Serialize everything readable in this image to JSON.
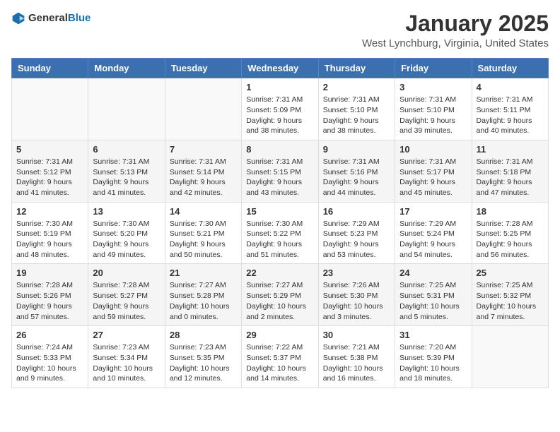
{
  "header": {
    "logo_general": "General",
    "logo_blue": "Blue",
    "month": "January 2025",
    "location": "West Lynchburg, Virginia, United States"
  },
  "weekdays": [
    "Sunday",
    "Monday",
    "Tuesday",
    "Wednesday",
    "Thursday",
    "Friday",
    "Saturday"
  ],
  "rows": [
    [
      {
        "day": "",
        "text": ""
      },
      {
        "day": "",
        "text": ""
      },
      {
        "day": "",
        "text": ""
      },
      {
        "day": "1",
        "text": "Sunrise: 7:31 AM\nSunset: 5:09 PM\nDaylight: 9 hours\nand 38 minutes."
      },
      {
        "day": "2",
        "text": "Sunrise: 7:31 AM\nSunset: 5:10 PM\nDaylight: 9 hours\nand 38 minutes."
      },
      {
        "day": "3",
        "text": "Sunrise: 7:31 AM\nSunset: 5:10 PM\nDaylight: 9 hours\nand 39 minutes."
      },
      {
        "day": "4",
        "text": "Sunrise: 7:31 AM\nSunset: 5:11 PM\nDaylight: 9 hours\nand 40 minutes."
      }
    ],
    [
      {
        "day": "5",
        "text": "Sunrise: 7:31 AM\nSunset: 5:12 PM\nDaylight: 9 hours\nand 41 minutes."
      },
      {
        "day": "6",
        "text": "Sunrise: 7:31 AM\nSunset: 5:13 PM\nDaylight: 9 hours\nand 41 minutes."
      },
      {
        "day": "7",
        "text": "Sunrise: 7:31 AM\nSunset: 5:14 PM\nDaylight: 9 hours\nand 42 minutes."
      },
      {
        "day": "8",
        "text": "Sunrise: 7:31 AM\nSunset: 5:15 PM\nDaylight: 9 hours\nand 43 minutes."
      },
      {
        "day": "9",
        "text": "Sunrise: 7:31 AM\nSunset: 5:16 PM\nDaylight: 9 hours\nand 44 minutes."
      },
      {
        "day": "10",
        "text": "Sunrise: 7:31 AM\nSunset: 5:17 PM\nDaylight: 9 hours\nand 45 minutes."
      },
      {
        "day": "11",
        "text": "Sunrise: 7:31 AM\nSunset: 5:18 PM\nDaylight: 9 hours\nand 47 minutes."
      }
    ],
    [
      {
        "day": "12",
        "text": "Sunrise: 7:30 AM\nSunset: 5:19 PM\nDaylight: 9 hours\nand 48 minutes."
      },
      {
        "day": "13",
        "text": "Sunrise: 7:30 AM\nSunset: 5:20 PM\nDaylight: 9 hours\nand 49 minutes."
      },
      {
        "day": "14",
        "text": "Sunrise: 7:30 AM\nSunset: 5:21 PM\nDaylight: 9 hours\nand 50 minutes."
      },
      {
        "day": "15",
        "text": "Sunrise: 7:30 AM\nSunset: 5:22 PM\nDaylight: 9 hours\nand 51 minutes."
      },
      {
        "day": "16",
        "text": "Sunrise: 7:29 AM\nSunset: 5:23 PM\nDaylight: 9 hours\nand 53 minutes."
      },
      {
        "day": "17",
        "text": "Sunrise: 7:29 AM\nSunset: 5:24 PM\nDaylight: 9 hours\nand 54 minutes."
      },
      {
        "day": "18",
        "text": "Sunrise: 7:28 AM\nSunset: 5:25 PM\nDaylight: 9 hours\nand 56 minutes."
      }
    ],
    [
      {
        "day": "19",
        "text": "Sunrise: 7:28 AM\nSunset: 5:26 PM\nDaylight: 9 hours\nand 57 minutes."
      },
      {
        "day": "20",
        "text": "Sunrise: 7:28 AM\nSunset: 5:27 PM\nDaylight: 9 hours\nand 59 minutes."
      },
      {
        "day": "21",
        "text": "Sunrise: 7:27 AM\nSunset: 5:28 PM\nDaylight: 10 hours\nand 0 minutes."
      },
      {
        "day": "22",
        "text": "Sunrise: 7:27 AM\nSunset: 5:29 PM\nDaylight: 10 hours\nand 2 minutes."
      },
      {
        "day": "23",
        "text": "Sunrise: 7:26 AM\nSunset: 5:30 PM\nDaylight: 10 hours\nand 3 minutes."
      },
      {
        "day": "24",
        "text": "Sunrise: 7:25 AM\nSunset: 5:31 PM\nDaylight: 10 hours\nand 5 minutes."
      },
      {
        "day": "25",
        "text": "Sunrise: 7:25 AM\nSunset: 5:32 PM\nDaylight: 10 hours\nand 7 minutes."
      }
    ],
    [
      {
        "day": "26",
        "text": "Sunrise: 7:24 AM\nSunset: 5:33 PM\nDaylight: 10 hours\nand 9 minutes."
      },
      {
        "day": "27",
        "text": "Sunrise: 7:23 AM\nSunset: 5:34 PM\nDaylight: 10 hours\nand 10 minutes."
      },
      {
        "day": "28",
        "text": "Sunrise: 7:23 AM\nSunset: 5:35 PM\nDaylight: 10 hours\nand 12 minutes."
      },
      {
        "day": "29",
        "text": "Sunrise: 7:22 AM\nSunset: 5:37 PM\nDaylight: 10 hours\nand 14 minutes."
      },
      {
        "day": "30",
        "text": "Sunrise: 7:21 AM\nSunset: 5:38 PM\nDaylight: 10 hours\nand 16 minutes."
      },
      {
        "day": "31",
        "text": "Sunrise: 7:20 AM\nSunset: 5:39 PM\nDaylight: 10 hours\nand 18 minutes."
      },
      {
        "day": "",
        "text": ""
      }
    ]
  ]
}
